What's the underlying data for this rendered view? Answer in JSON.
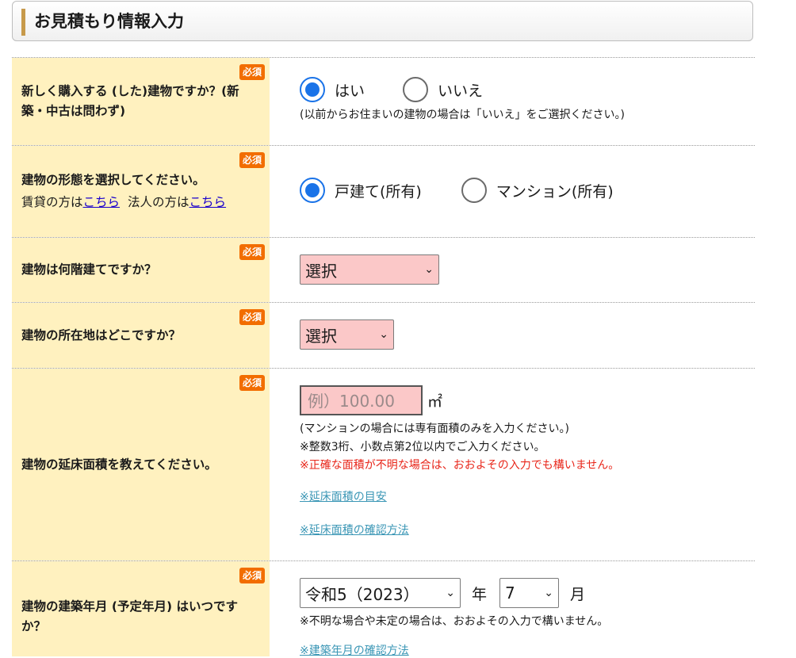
{
  "header": {
    "title": "お見積もり情報入力"
  },
  "required_badge": "必須",
  "q1": {
    "label": "新しく購入する (した)建物ですか？(新築・中古は問わず)",
    "options": [
      "はい",
      "いいえ"
    ],
    "selected": 0,
    "note": "(以前からお住まいの建物の場合は「いいえ」をご選択ください。)"
  },
  "q2": {
    "label": "建物の形態を選択してください。",
    "sub_prefix_1": "賃貸の方は",
    "sub_link_1": "こちら",
    "sub_prefix_2": "法人の方は",
    "sub_link_2": "こちら",
    "options": [
      "戸建て(所有)",
      "マンション(所有)"
    ],
    "selected": 0
  },
  "q3": {
    "label": "建物は何階建てですか？",
    "select_value": "選択"
  },
  "q4": {
    "label": "建物の所在地はどこですか？",
    "select_value": "選択"
  },
  "q5": {
    "label": "建物の延床面積を教えてください。",
    "placeholder": "例）100.00",
    "unit": "㎡",
    "note1": "(マンションの場合には専有面積のみを入力ください。)",
    "note2": "※整数3桁、小数点第2位以内でご入力ください。",
    "note3": "※正確な面積が不明な場合は、おおよその入力でも構いません。",
    "link1": "※延床面積の目安",
    "link2": "※延床面積の確認方法"
  },
  "q6": {
    "label": "建物の建築年月 (予定年月) はいつですか？",
    "year_value": "令和5（2023）",
    "year_unit": "年",
    "month_value": "7",
    "month_unit": "月",
    "note": "※不明な場合や未定の場合は、おおよその入力で構いません。",
    "link": "※建築年月の確認方法"
  },
  "colors": {
    "label_bg": "#fff1bf",
    "required": "#f26d00",
    "select_bg": "#fbc8c8",
    "radio_checked": "#1a73e8"
  }
}
